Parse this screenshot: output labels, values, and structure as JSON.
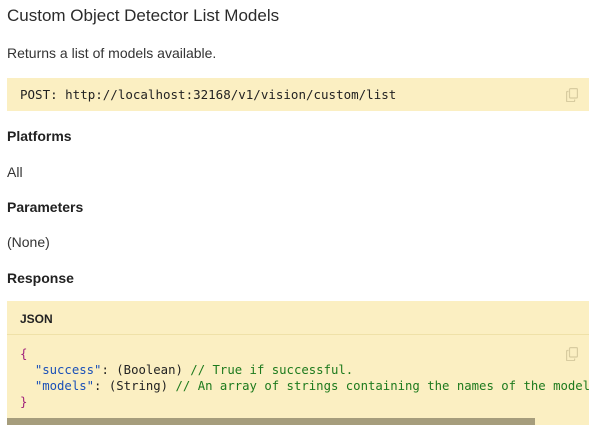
{
  "page": {
    "title": "Custom Object Detector List Models",
    "description": "Returns a list of models available."
  },
  "endpoint": {
    "text": "POST: http://localhost:32168/v1/vision/custom/list"
  },
  "sections": {
    "platforms_heading": "Platforms",
    "platforms_value": "All",
    "parameters_heading": "Parameters",
    "parameters_value": "(None)",
    "response_heading": "Response"
  },
  "response_code": {
    "language_label": "JSON",
    "open_brace": "{",
    "lines": [
      {
        "key": "\"success\"",
        "sep": ": ",
        "type": "(Boolean)",
        "comment": " // True if successful."
      },
      {
        "key": "\"models\"",
        "sep": ": ",
        "type": "(String)",
        "comment": " // An array of strings containing the names of the models ins"
      }
    ],
    "close_brace": "}"
  },
  "icons": {
    "copy": "copy-icon"
  }
}
